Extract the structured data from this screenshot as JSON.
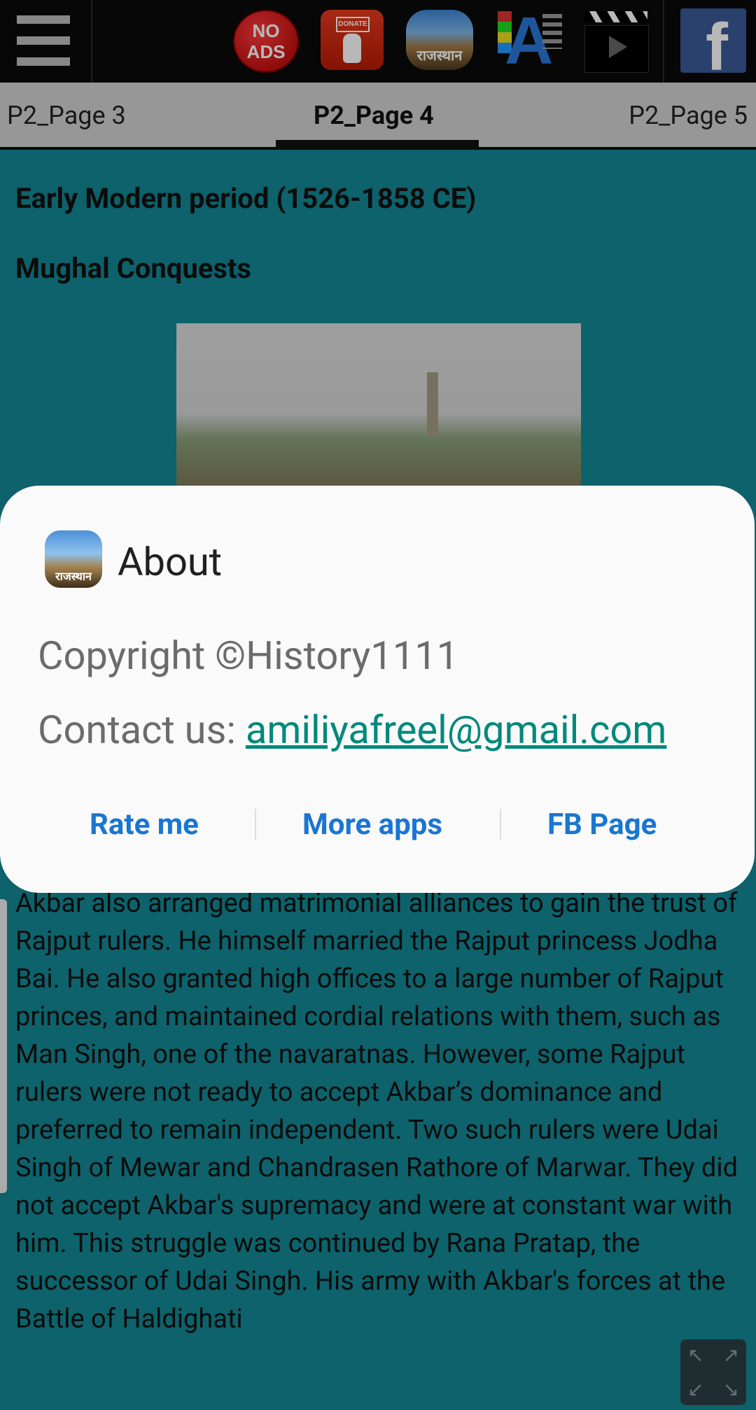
{
  "toolbar": {
    "no_ads_line1": "NO",
    "no_ads_line2": "ADS",
    "donate_label": "DONATE",
    "app_icon_text": "राजस्थान",
    "facebook_letter": "f"
  },
  "tabs": [
    "P2_Page 3",
    "P2_Page 4",
    "P2_Page 5"
  ],
  "content": {
    "heading1": "Early Modern period (1526-1858 CE)",
    "heading2": "Mughal Conquests",
    "paragraph": "Akbar also arranged matrimonial alliances to gain the trust of Rajput rulers. He himself married the Rajput princess Jodha Bai. He also granted high offices to a large number of Rajput princes, and maintained cordial relations with them, such as Man Singh, one of the navaratnas. However, some Rajput rulers were not ready to accept Akbar’s dominance and preferred to remain independent. Two such rulers were Udai Singh of Mewar and Chandrasen Rathore of Marwar. They did not accept Akbar's supremacy and were at constant war with him. This struggle was continued by Rana Pratap, the successor of Udai Singh. His army with Akbar's forces at the Battle of Haldighati"
  },
  "dialog": {
    "icon_text": "राजस्थान",
    "title": "About",
    "copyright": "Copyright ©History1111",
    "contact_label": "Contact us: ",
    "email": "amiliyafreel@gmail.com",
    "buttons": {
      "rate": "Rate me",
      "more": "More apps",
      "fb": "FB Page"
    }
  },
  "colors": {
    "content_bg": "#138895",
    "link_blue": "#1976d2",
    "email_teal": "#00897b"
  }
}
